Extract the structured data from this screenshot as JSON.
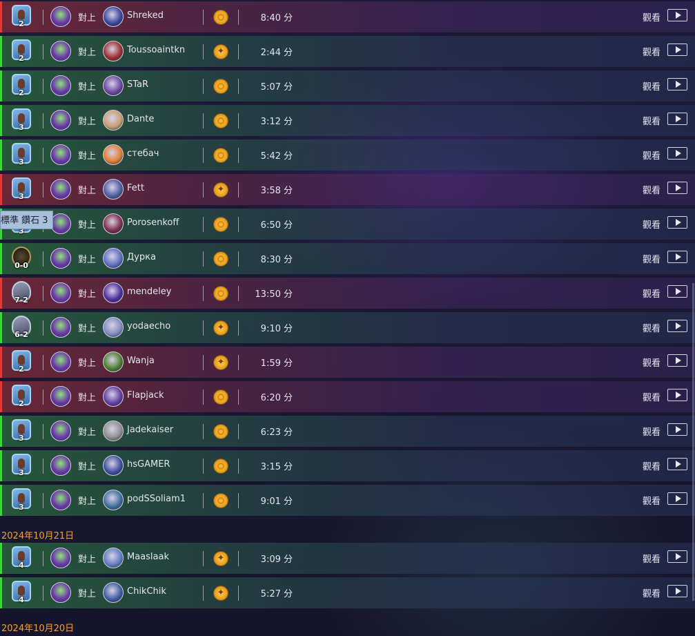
{
  "colors": {
    "win": "#3fd43f",
    "loss": "#e03a3a",
    "date": "#f0a23a",
    "tooltip_bg": "#a8c0dc"
  },
  "tooltip": "標準 鑽石 3",
  "labels": {
    "vs": "對上",
    "watch": "觀看"
  },
  "groups": [
    {
      "date": "",
      "rows": [
        {
          "result": "loss",
          "rank_type": "diamond",
          "rank": "2",
          "opponent": "Shreked",
          "coin": "gold",
          "duration": "8:40 分"
        },
        {
          "result": "win",
          "rank_type": "diamond",
          "rank": "2",
          "opponent": "Toussoaintkn",
          "coin": "swirl",
          "duration": "2:44 分"
        },
        {
          "result": "win",
          "rank_type": "diamond",
          "rank": "2",
          "opponent": "STaR",
          "coin": "gold",
          "duration": "5:07 分"
        },
        {
          "result": "win",
          "rank_type": "diamond",
          "rank": "3",
          "opponent": "Dante",
          "coin": "gold",
          "duration": "3:12 分"
        },
        {
          "result": "win",
          "rank_type": "diamond",
          "rank": "3",
          "opponent": "стебач",
          "coin": "gold",
          "duration": "5:42 分"
        },
        {
          "result": "loss",
          "rank_type": "diamond",
          "rank": "3",
          "opponent": "Fett",
          "coin": "swirl",
          "duration": "3:58 分"
        },
        {
          "result": "win",
          "rank_type": "diamond",
          "rank": "3",
          "opponent": "Porosenkoff",
          "coin": "gold",
          "duration": "6:50 分"
        },
        {
          "result": "win",
          "rank_type": "legend",
          "rank": "0-0",
          "opponent": "Дурка",
          "coin": "gold",
          "duration": "8:30 分"
        },
        {
          "result": "loss",
          "rank_type": "mid",
          "rank": "7-2",
          "opponent": "mendeley",
          "coin": "gold",
          "duration": "13:50 分"
        },
        {
          "result": "win",
          "rank_type": "mid",
          "rank": "6-2",
          "opponent": "yodaecho",
          "coin": "swirl",
          "duration": "9:10 分"
        },
        {
          "result": "loss",
          "rank_type": "diamond",
          "rank": "2",
          "opponent": "Wanja",
          "coin": "swirl",
          "duration": "1:59 分"
        },
        {
          "result": "loss",
          "rank_type": "diamond",
          "rank": "2",
          "opponent": "Flapjack",
          "coin": "gold",
          "duration": "6:20 分"
        },
        {
          "result": "win",
          "rank_type": "diamond",
          "rank": "3",
          "opponent": "Jadekaiser",
          "coin": "gold",
          "duration": "6:23 分"
        },
        {
          "result": "win",
          "rank_type": "diamond",
          "rank": "3",
          "opponent": "hsGAMER",
          "coin": "gold",
          "duration": "3:15 分"
        },
        {
          "result": "win",
          "rank_type": "diamond",
          "rank": "3",
          "opponent": "podSSoliam1",
          "coin": "gold",
          "duration": "9:01 分"
        }
      ]
    },
    {
      "date": "2024年10月21日",
      "rows": [
        {
          "result": "win",
          "rank_type": "diamond",
          "rank": "4",
          "opponent": "Maaslaak",
          "coin": "swirl",
          "duration": "3:09 分"
        },
        {
          "result": "win",
          "rank_type": "diamond",
          "rank": "4",
          "opponent": "ChikChik",
          "coin": "swirl",
          "duration": "5:27 分"
        }
      ]
    },
    {
      "date": "2024年10月20日",
      "rows": []
    }
  ]
}
